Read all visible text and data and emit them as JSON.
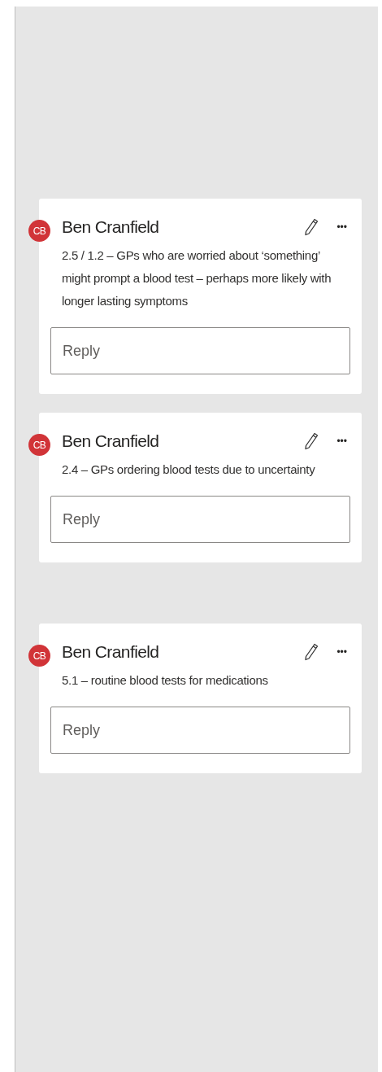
{
  "comments": [
    {
      "initials": "CB",
      "author": "Ben Cranfield",
      "text": "2.5 / 1.2 – GPs who are worried about ‘something’ might prompt a blood test – perhaps more likely with longer lasting symptoms",
      "more": "•••",
      "reply": {
        "placeholder": "Reply"
      }
    },
    {
      "initials": "CB",
      "author": "Ben Cranfield",
      "text": "2.4 – GPs ordering blood tests due to uncertainty",
      "more": "•••",
      "reply": {
        "placeholder": "Reply"
      }
    },
    {
      "initials": "CB",
      "author": "Ben Cranfield",
      "text": "5.1 – routine blood tests for medications",
      "more": "•••",
      "reply": {
        "placeholder": "Reply"
      }
    }
  ]
}
